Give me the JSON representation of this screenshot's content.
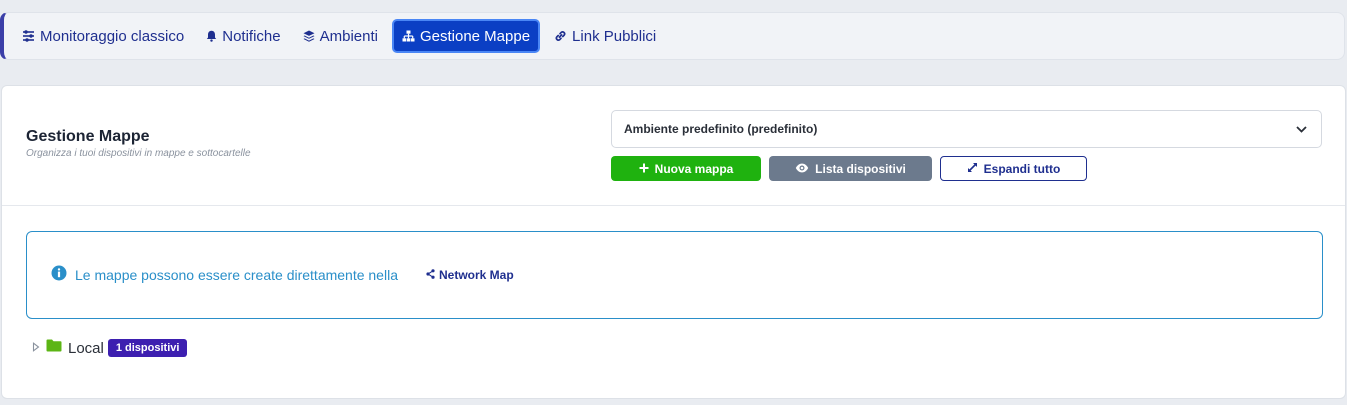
{
  "nav": {
    "items": [
      {
        "label": "Monitoraggio classico",
        "icon": "sliders-icon",
        "active": false
      },
      {
        "label": "Notifiche",
        "icon": "bell-icon",
        "active": false
      },
      {
        "label": "Ambienti",
        "icon": "layers-icon",
        "active": false
      },
      {
        "label": "Gestione Mappe",
        "icon": "sitemap-icon",
        "active": true
      },
      {
        "label": "Link Pubblici",
        "icon": "link-icon",
        "active": false
      }
    ]
  },
  "header": {
    "title": "Gestione Mappe",
    "subtitle": "Organizza i tuoi dispositivi in mappe e sottocartelle",
    "environment_select": {
      "value": "Ambiente predefinito (predefinito)"
    },
    "buttons": {
      "new_map": "Nuova mappa",
      "device_list": "Lista dispositivi",
      "expand_all": "Espandi tutto"
    }
  },
  "info": {
    "text": "Le mappe possono essere create direttamente nella",
    "link": "Network Map"
  },
  "tree": {
    "items": [
      {
        "label": "Local",
        "badge": "1 dispositivi"
      }
    ]
  },
  "colors": {
    "accent": "#0b3fc4",
    "success": "#1fb20f",
    "secondary": "#6c7a8d",
    "info": "#2a8fc9",
    "badge": "#3d1fb0",
    "folder": "#5cb515"
  }
}
